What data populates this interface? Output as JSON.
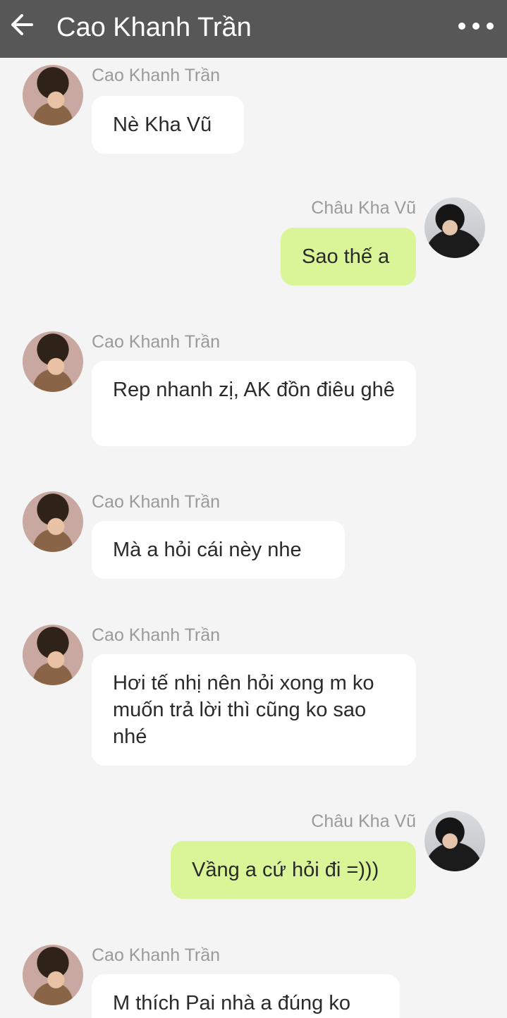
{
  "header": {
    "title": "Cao Khanh Trần",
    "back_icon": "arrow-left-icon",
    "more_icon": "more-horizontal-icon"
  },
  "colors": {
    "header_bg": "#575757",
    "chat_bg": "#f4f4f4",
    "incoming_bubble": "#ffffff",
    "outgoing_bubble": "#d9f598",
    "sender_name": "#9a9a9a"
  },
  "messages": [
    {
      "sender": "Cao Khanh Trần",
      "direction": "incoming",
      "text": "Nè Kha Vũ"
    },
    {
      "sender": "Châu Kha Vũ",
      "direction": "outgoing",
      "text": "Sao thế a"
    },
    {
      "sender": "Cao Khanh Trần",
      "direction": "incoming",
      "text": "Rep nhanh zị, AK đồn điêu ghê"
    },
    {
      "sender": "Cao Khanh Trần",
      "direction": "incoming",
      "text": "Mà a hỏi cái nèy nhe"
    },
    {
      "sender": "Cao Khanh Trần",
      "direction": "incoming",
      "text": "Hơi tế nhị nên hỏi xong m ko muốn trả lời thì cũng ko sao nhé"
    },
    {
      "sender": "Châu Kha Vũ",
      "direction": "outgoing",
      "text": "Vầng a cứ hỏi đi =)))"
    },
    {
      "sender": "Cao Khanh Trần",
      "direction": "incoming",
      "text": "M thích Pai nhà a đúng ko"
    }
  ]
}
